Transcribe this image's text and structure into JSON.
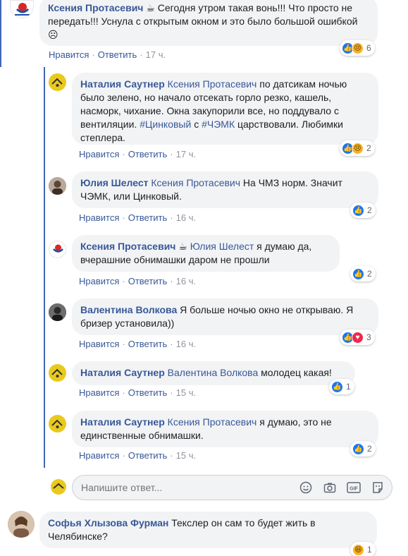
{
  "comments": [
    {
      "author": "Ксения Протасевич",
      "mention": "",
      "badge": "☕",
      "text": "Сегодня утром такая вонь!!! Что просто не передать!!! Уснула с открытым окном и это было большой ошибкой ☹",
      "like_label": "Нравится",
      "reply_label": "Ответить",
      "time": "17 ч.",
      "reaction_count": "6"
    },
    {
      "author": "Наталия Саутнер",
      "mention": "Ксения Протасевич",
      "text_a": "по датсикам ночью было зелено, но начало отсекать горло резко, кашель, насморк, чихание. Окна закупорили все, но поддувало с вентиляции.",
      "hashtag1": "#Цинковый",
      "text_b": "с",
      "hashtag2": "#ЧЭМК",
      "text_c": "царствовали. Любимки степлера.",
      "like_label": "Нравится",
      "reply_label": "Ответить",
      "time": "17 ч.",
      "reaction_count": "2"
    },
    {
      "author": "Юлия Шелест",
      "mention": "Ксения Протасевич",
      "text": "На ЧМЗ норм. Значит ЧЭМК, или Цинковый.",
      "like_label": "Нравится",
      "reply_label": "Ответить",
      "time": "16 ч.",
      "reaction_count": "2"
    },
    {
      "author": "Ксения Протасевич",
      "badge": "☕",
      "mention": "Юлия Шелест",
      "text": "я думаю да, вчерашние обнимашки даром не прошли",
      "like_label": "Нравится",
      "reply_label": "Ответить",
      "time": "16 ч.",
      "reaction_count": "2"
    },
    {
      "author": "Валентина Волкова",
      "mention": "",
      "text": "Я больше ночью окно не открываю. Я бризер установила))",
      "like_label": "Нравится",
      "reply_label": "Ответить",
      "time": "16 ч.",
      "reaction_count": "3"
    },
    {
      "author": "Наталия Саутнер",
      "mention": "Валентина Волкова",
      "text": "молодец какая!",
      "like_label": "Нравится",
      "reply_label": "Ответить",
      "time": "15 ч.",
      "reaction_count": "1"
    },
    {
      "author": "Наталия Саутнер",
      "mention": "Ксения Протасевич",
      "text": "я думаю, это не единственные обнимашки.",
      "like_label": "Нравится",
      "reply_label": "Ответить",
      "time": "15 ч.",
      "reaction_count": "2"
    },
    {
      "author": "Софья Хлызова Фурман",
      "mention": "",
      "text": "Текслер он сам то будет жить в Челябинске?",
      "reaction_count": "1"
    }
  ],
  "reply_box": {
    "placeholder": "Напишите ответ..."
  },
  "icons": [
    "emoji-icon",
    "camera-icon",
    "gif-icon",
    "sticker-icon"
  ],
  "colors": {
    "link": "#385898",
    "bubble_bg": "#f2f3f5",
    "thread_rule": "#4267b2",
    "meta": "#90949c"
  }
}
